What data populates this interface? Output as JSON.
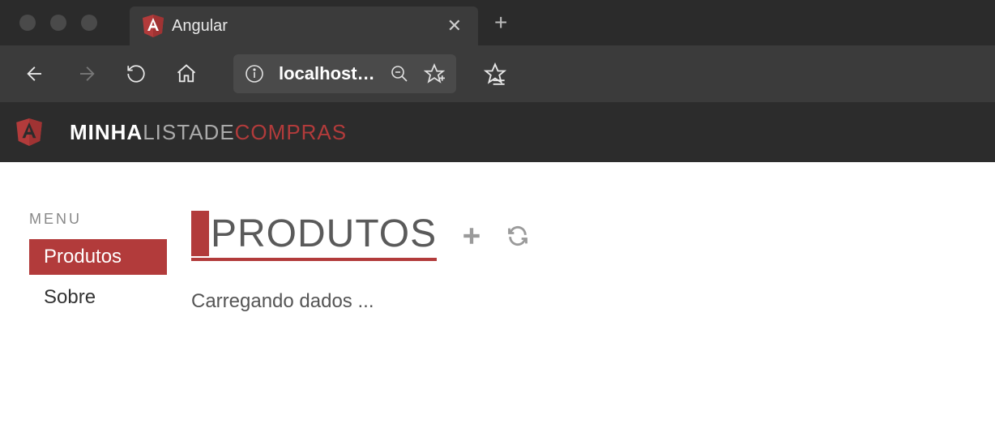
{
  "browser": {
    "tab_title": "Angular",
    "address": "localhost…"
  },
  "app": {
    "brand_part1": "MINHA",
    "brand_part2": "LISTADE",
    "brand_part3": "COMPRAS"
  },
  "sidebar": {
    "menu_label": "MENU",
    "items": [
      {
        "label": "Produtos",
        "active": true
      },
      {
        "label": "Sobre",
        "active": false
      }
    ]
  },
  "main": {
    "title": "PRODUTOS",
    "status": "Carregando dados ..."
  }
}
